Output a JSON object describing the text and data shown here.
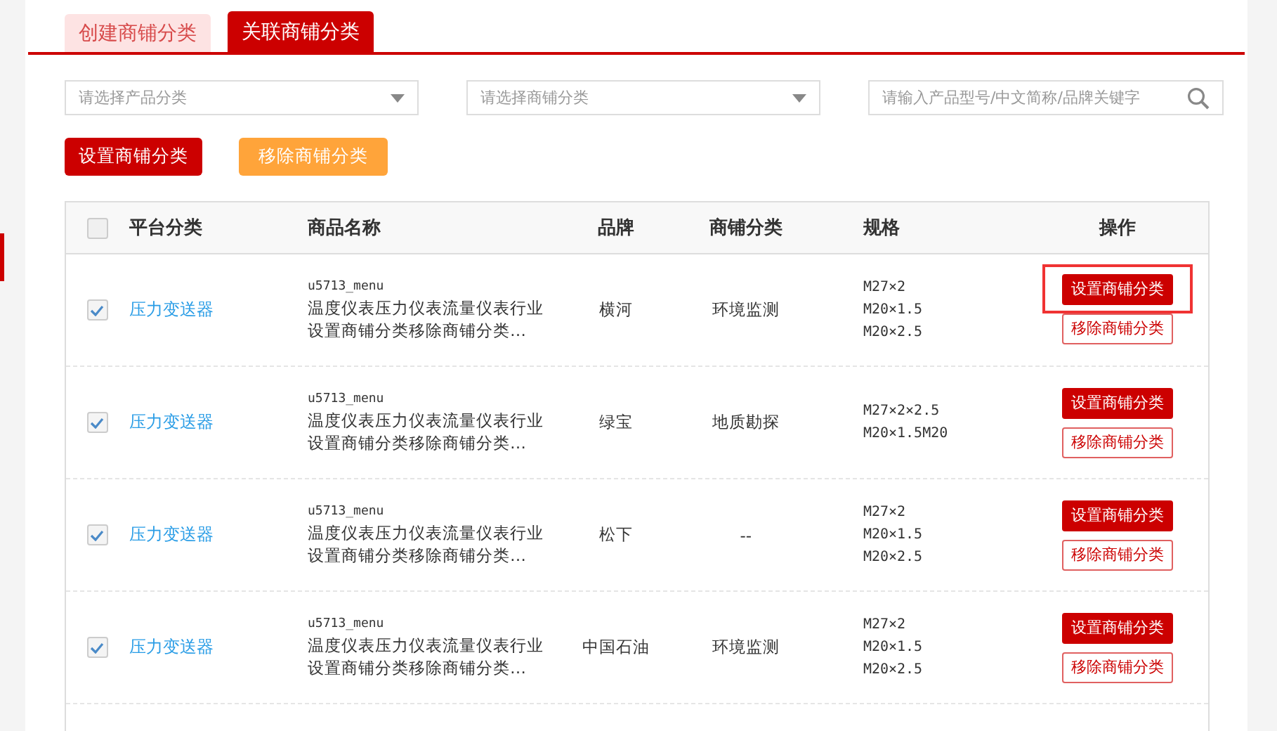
{
  "tabs": [
    {
      "label": "创建商铺分类",
      "selected": false
    },
    {
      "label": "关联商铺分类",
      "selected": true
    }
  ],
  "filters": [
    {
      "kind": "select",
      "placeholder": "请选择产品分类"
    },
    {
      "kind": "select",
      "placeholder": "请选择商铺分类"
    },
    {
      "kind": "search",
      "placeholder": "请输入产品型号/中文简称/品牌关键字"
    }
  ],
  "actions": [
    {
      "label": "设置商铺分类",
      "kind": "primary"
    },
    {
      "label": "移除商铺分类",
      "kind": "secondary"
    }
  ],
  "table": {
    "all_checked": false,
    "columns": [
      "平台分类",
      "商品名称",
      "品牌",
      "商铺分类",
      "规格",
      "操作"
    ],
    "rows": [
      {
        "checked": true,
        "category": "压力变送器",
        "code": "u5713_menu",
        "name_lines": [
          "温度仪表压力仪表流量仪表行业",
          "设置商铺分类移除商铺分类…"
        ],
        "brand": "横河",
        "shop_category": "环境监测",
        "specs": [
          "M27×2",
          "M20×1.5",
          "M20×2.5"
        ],
        "buttons": [
          "设置商铺分类",
          "移除商铺分类"
        ],
        "highlighted": true
      },
      {
        "checked": true,
        "category": "压力变送器",
        "code": "u5713_menu",
        "name_lines": [
          "温度仪表压力仪表流量仪表行业",
          "设置商铺分类移除商铺分类…"
        ],
        "brand": "绿宝",
        "shop_category": "地质勘探",
        "specs": [
          "M27×2×2.5",
          "M20×1.5M20"
        ],
        "buttons": [
          "设置商铺分类",
          "移除商铺分类"
        ],
        "highlighted": false
      },
      {
        "checked": true,
        "category": "压力变送器",
        "code": "u5713_menu",
        "name_lines": [
          "温度仪表压力仪表流量仪表行业",
          "设置商铺分类移除商铺分类…"
        ],
        "brand": "松下",
        "shop_category": "--",
        "specs": [
          "M27×2",
          "M20×1.5",
          "M20×2.5"
        ],
        "buttons": [
          "设置商铺分类",
          "移除商铺分类"
        ],
        "highlighted": false
      },
      {
        "checked": true,
        "category": "压力变送器",
        "code": "u5713_menu",
        "name_lines": [
          "温度仪表压力仪表流量仪表行业",
          "设置商铺分类移除商铺分类…"
        ],
        "brand": "中国石油",
        "shop_category": "环境监测",
        "specs": [
          "M27×2",
          "M20×1.5",
          "M20×2.5"
        ],
        "buttons": [
          "设置商铺分类",
          "移除商铺分类"
        ],
        "highlighted": false
      }
    ]
  }
}
